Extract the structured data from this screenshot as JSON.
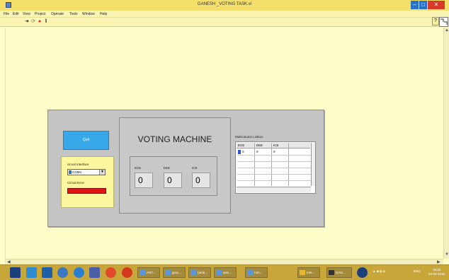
{
  "window": {
    "title": "GANESH _VOTING TASK.vi",
    "min_label": "–",
    "max_label": "□",
    "close_label": "✕"
  },
  "menu": [
    "File",
    "Edit",
    "View",
    "Project",
    "Operate",
    "Tools",
    "Window",
    "Help"
  ],
  "toolbar": {
    "run_glyph": "➜",
    "run_cont_glyph": "⟳",
    "abort_glyph": "●",
    "pause_glyph": "‖",
    "help_glyph": "?"
  },
  "panel": {
    "quit_label": "Quit",
    "circuit_interface_label": "circuit Interface",
    "circuit_interface_value": "COM4",
    "circuit_error_label": "Circuit Error",
    "heading": "VOTING MACHINE",
    "counters": [
      {
        "label": "ECE",
        "value": "0"
      },
      {
        "label": "EEE",
        "value": "0"
      },
      {
        "label": "ICE",
        "value": "0"
      }
    ],
    "listbox_title": "Multicolumn Listbox",
    "listbox_headers": [
      "ECE",
      "EEE",
      "ICE",
      ""
    ],
    "listbox_row": [
      "0",
      "0",
      "0",
      ""
    ]
  },
  "taskbar": {
    "apps": [
      "ANT...",
      "grou...",
      "(amb...",
      "ansi...",
      "rom...",
      "Inte...",
      "GAN..."
    ],
    "language": "ENG",
    "clock_time": "18:20",
    "clock_date": "04-02-2018"
  },
  "colors": {
    "titlebar": "#f3df69",
    "canvas": "#fffdc8",
    "panel": "#c4c4c4",
    "quit_button": "#38a8e8",
    "error_led": "#e01414",
    "taskbar": "#c9a63a"
  }
}
